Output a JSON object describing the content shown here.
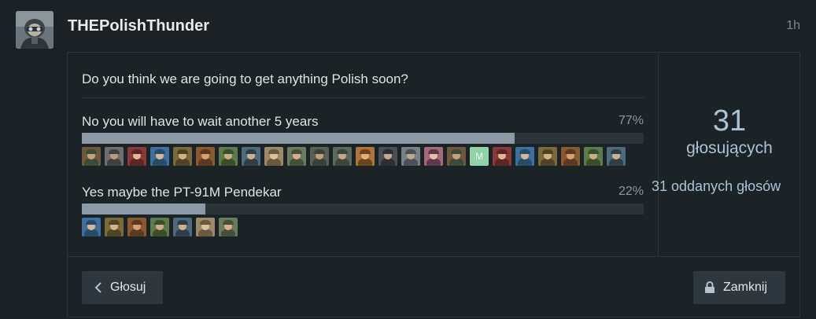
{
  "post": {
    "username": "THEPolishThunder",
    "time": "1h",
    "avatar_icon": "soldier-avatar-icon"
  },
  "poll": {
    "question": "Do you think we are going to get anything Polish soon?",
    "options": [
      {
        "label": "No you will have to wait another 5 years",
        "percent_label": "77%",
        "percent": 77,
        "voter_count": 24
      },
      {
        "label": "Yes maybe the PT-91M Pendekar",
        "percent_label": "22%",
        "percent": 22,
        "voter_count": 7
      }
    ],
    "voters_count": "31",
    "voters_label": "głosujących",
    "votes_cast": "31 oddanych głosów",
    "vote_button": "Głosuj",
    "close_button": "Zamknij",
    "special_voter_letter": "M"
  },
  "colors": {
    "background": "#1b2125",
    "bar_fill": "#8b9aa4",
    "bar_track": "#2b3439",
    "accent_text": "#a9c3d5",
    "special_voter_bg": "#8fd4a8"
  }
}
